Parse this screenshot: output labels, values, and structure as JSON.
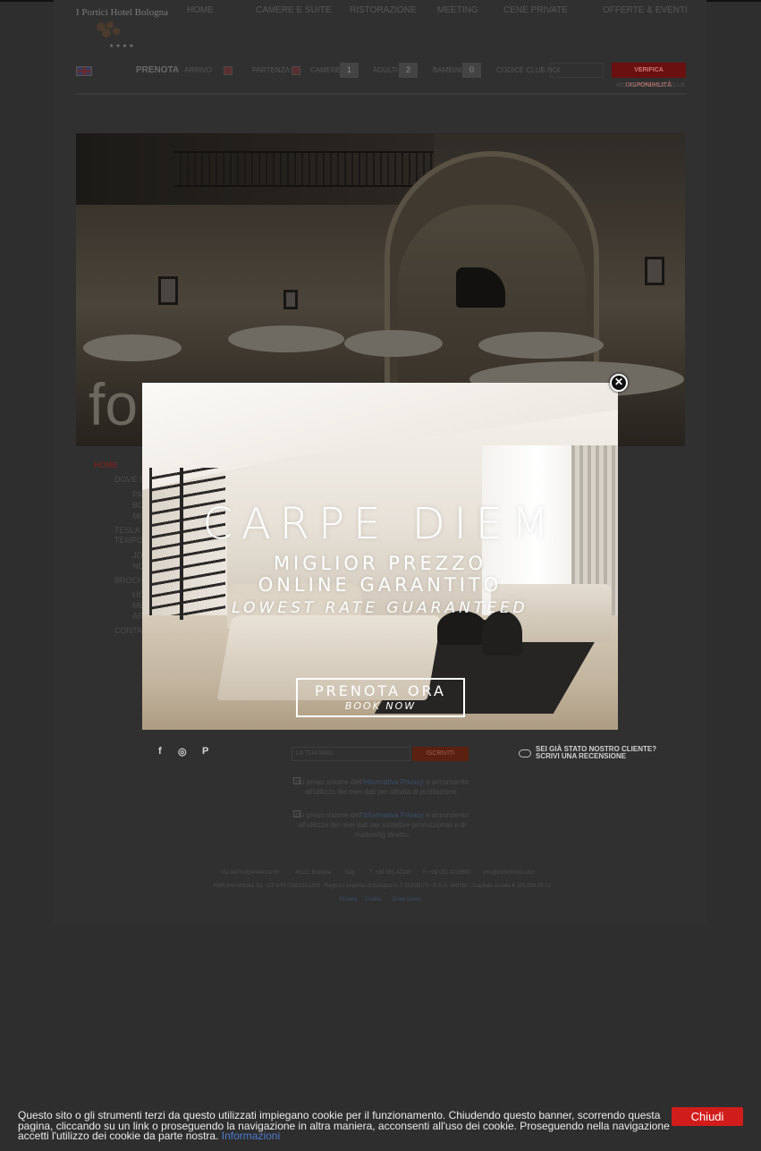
{
  "logo": {
    "text": "I Portici Hotel Bologna",
    "stars": "★★★★"
  },
  "nav": {
    "home": "HOME",
    "rooms": "CAMERE E SUITE",
    "dining": "RISTORAZIONE",
    "meeting": "MEETING",
    "private_dinners": "CENE PRIVATE",
    "offers": "OFFERTE & EVENTI"
  },
  "booking": {
    "language_flag": "uk-flag-icon",
    "book_label": "PRENOTA",
    "arrival_label": "ARRIVO",
    "departure_label": "PARTENZA",
    "rooms_label": "CAMERE",
    "rooms_value": "1",
    "adults_label": "ADULTI",
    "adults_value": "2",
    "children_label": "BAMBINI",
    "children_value": "0",
    "promo_label": "CODICE CLUB NOI",
    "verify_button": "VERIFICA DISPONIBILITÀ",
    "manage_link": "MODIFICA / CANCELLA"
  },
  "hero": {
    "caption": "fo"
  },
  "side_menu": {
    "home": "HOME",
    "where": "DOVE S",
    "sub1a": "PA",
    "sub1b": "BO",
    "sub1c": "MI",
    "tesla": "TESLA C",
    "tempo": "TEMPO",
    "sub2a": "JO",
    "sub2b": "NO",
    "brochure": "BROCHU",
    "sub3a": "HO",
    "sub3b": "ME",
    "sub3c": "AR",
    "contacts": "CONTAT"
  },
  "footer": {
    "social": {
      "facebook": "f",
      "instagram": "◎",
      "pinterest": "P"
    },
    "newsletter_placeholder": "LA TUA MAIL",
    "subscribe_button": "ISCRIVITI",
    "review_line1": "SEI GIÀ STATO NOSTRO CLIENTE?",
    "review_line2": "SCRIVI UNA RECENSIONE",
    "consent1_prefix": "Ho preso visione dell'",
    "consent1_link": "Informativa Privacy",
    "consent1_suffix": " e acconsento all'utilizzo dei miei dati per attività di profilazione.",
    "consent2_prefix": "Ho preso visione dell'",
    "consent2_link": "Informativa Privacy",
    "consent2_suffix": " e acconsento all'utilizzo dei miei dati per iniziative promozionali e di marketing diretto.",
    "address": "Via dell'Indipendenza 69",
    "city": "40121 Bologna",
    "country": "Italy",
    "phone": "T. +39 051 42185",
    "fax": "F. +39 051 4218550",
    "email": "info@porticihotel.com",
    "company_line": "RBR Immobiliare SA - CF e PI 02553101209 - Registro Imprese di Bologna n. T 55358073 - R.E.A. 448265 - Capitale sociale € 101.000,00 i.v.",
    "link_privacy": "Privacy",
    "link_cookie": "Cookie",
    "link_where": "Dove siamo"
  },
  "popup": {
    "title": "CARPE DIEM",
    "line1": "MIGLIOR PREZZO",
    "line2": "ONLINE GARANTITO",
    "line3": "LOWEST RATE GUARANTEED",
    "button_line1": "PRENOTA ORA",
    "button_line2": "BOOK NOW",
    "close_icon": "close-icon"
  },
  "cookie_banner": {
    "text": "Questo sito o gli strumenti terzi da questo utilizzati impiegano cookie per il funzionamento. Chiudendo questo banner, scorrendo questa pagina, cliccando su un link o proseguendo la navigazione in altra maniera, acconsenti all'uso dei cookie. Proseguendo nella navigazione accetti l'utilizzo dei cookie da parte nostra.",
    "info_link": "Informazioni",
    "close_button": "Chiudi"
  },
  "colors": {
    "backdrop": "#2e2e2e",
    "cookie_button": "#d11c1c",
    "info_link": "#4d7bd0",
    "verify_button": "#6a1010"
  }
}
